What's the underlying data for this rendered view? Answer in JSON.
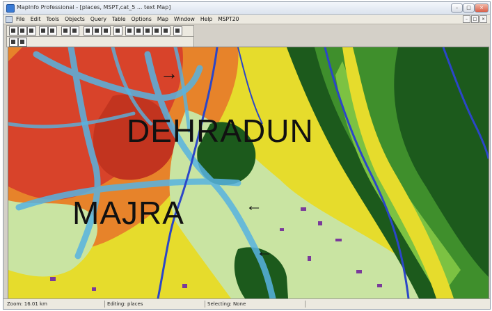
{
  "window": {
    "title": "MapInfo Professional - [places, MSPT,cat_5 ... text Map]"
  },
  "menu": {
    "items": [
      "File",
      "Edit",
      "Tools",
      "Objects",
      "Query",
      "Table",
      "Options",
      "Map",
      "Window",
      "Help",
      "MSPT20"
    ]
  },
  "map": {
    "labels": {
      "city": "DEHRADUN",
      "locality": "MAJRA"
    },
    "arrow_glyph": "→",
    "colors": {
      "urban_red": "#d8432a",
      "urban_orange": "#e7832a",
      "fringe_yellow": "#e6dc2c",
      "agri_pale_green": "#c9e4a2",
      "forest_dark": "#1c5a1c",
      "forest_mid": "#3f8f2c",
      "scrub_green": "#7cc242",
      "roads_cyan": "#57b3e0",
      "river_blue": "#2b46c8",
      "plots_purple": "#7a3a9a"
    }
  },
  "status": {
    "zoom": "Zoom: 16.01 km",
    "editing": "Editing: places",
    "selecting": "Selecting: None"
  }
}
